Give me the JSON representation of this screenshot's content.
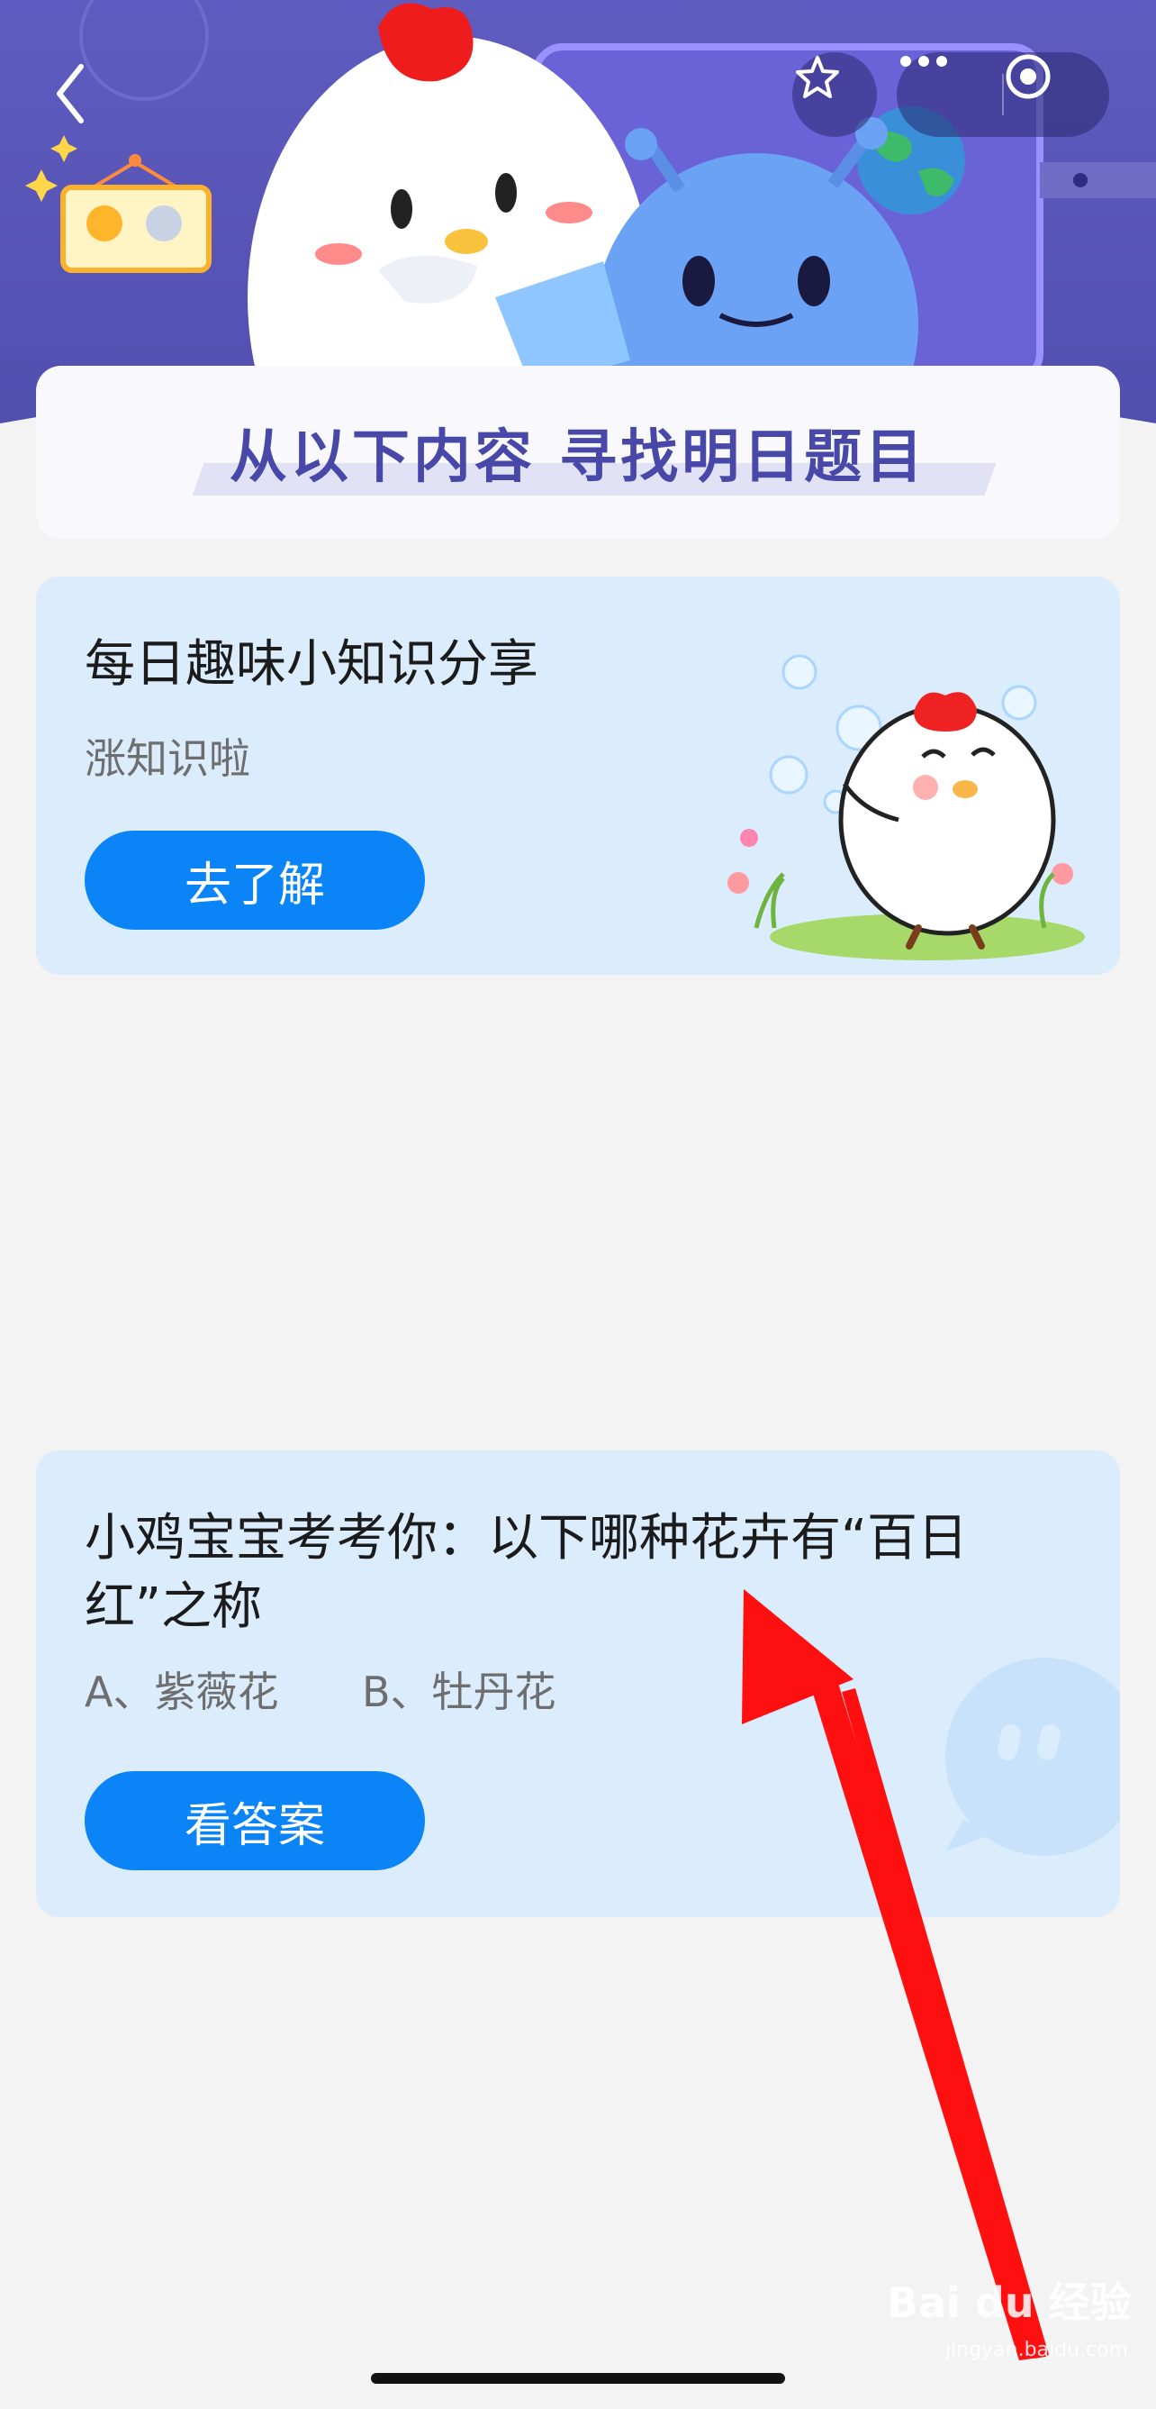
{
  "header": {
    "back_icon": "chevron-left-icon",
    "star_icon": "star-icon",
    "more_icon": "more-dots-icon",
    "close_icon": "target-circle-icon"
  },
  "banner": {
    "title": "从以下内容  寻找明日题目"
  },
  "card_knowledge": {
    "title": "每日趣味小知识分享",
    "subtitle": "涨知识啦",
    "button_label": "去了解"
  },
  "card_question": {
    "question": "小鸡宝宝考考你：以下哪种花卉有“百日红”之称",
    "option_a": "A、紫薇花",
    "option_b": "B、牡丹花",
    "button_label": "看答案"
  },
  "watermark": {
    "brand": "Bai du 经验",
    "url": "jingyan.baidu.com"
  },
  "colors": {
    "header_bg": "#5a57b9",
    "button_blue": "#0a84f6",
    "card_bg": "#dbecfd",
    "annotation_arrow": "#ff0f0f"
  }
}
